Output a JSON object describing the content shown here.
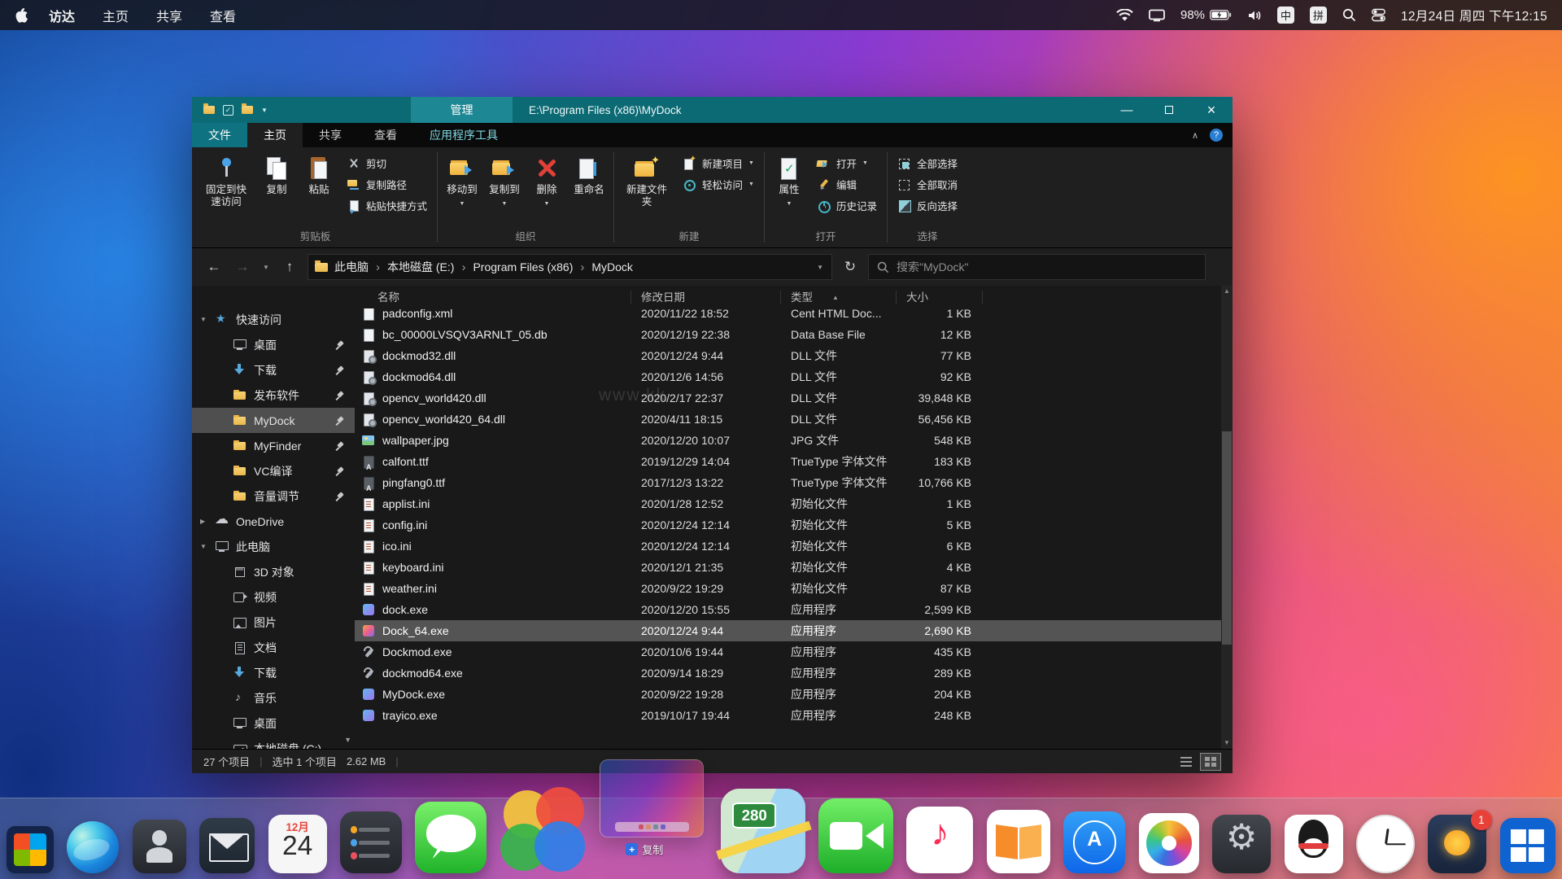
{
  "watermark": "www.kk",
  "menubar": {
    "app_menus": [
      "访达",
      "主页",
      "共享",
      "查看"
    ],
    "battery_percent": "98%",
    "input_cn": "中",
    "input_pin": "拼",
    "datetime": "12月24日 周四 下午12:15"
  },
  "window": {
    "manage_label": "管理",
    "title": "E:\\Program Files (x86)\\MyDock",
    "tabs": [
      {
        "label": "文件",
        "accent": true
      },
      {
        "label": "主页",
        "active": true
      },
      {
        "label": "共享"
      },
      {
        "label": "查看"
      },
      {
        "label": "应用程序工具",
        "contextual": true
      }
    ]
  },
  "ribbon": {
    "groups": [
      {
        "label": "剪贴板",
        "large": [
          {
            "label": "固定到快速访问",
            "icon": "pin"
          },
          {
            "label": "复制",
            "icon": "copy"
          },
          {
            "label": "粘贴",
            "icon": "paste"
          }
        ],
        "small": [
          {
            "label": "剪切",
            "icon": "cut"
          },
          {
            "label": "复制路径",
            "icon": "path"
          },
          {
            "label": "粘贴快捷方式",
            "icon": "shortcut"
          }
        ]
      },
      {
        "label": "组织",
        "large": [
          {
            "label": "移动到",
            "icon": "moveto",
            "dd": true
          },
          {
            "label": "复制到",
            "icon": "copyto",
            "dd": true
          },
          {
            "label": "删除",
            "icon": "delete",
            "dd": true
          },
          {
            "label": "重命名",
            "icon": "rename"
          }
        ]
      },
      {
        "label": "新建",
        "large": [
          {
            "label": "新建文件夹",
            "icon": "newfolder"
          }
        ],
        "small": [
          {
            "label": "新建项目",
            "icon": "newitem",
            "dd": true
          },
          {
            "label": "轻松访问",
            "icon": "easyaccess",
            "dd": true
          }
        ]
      },
      {
        "label": "打开",
        "large": [
          {
            "label": "属性",
            "icon": "properties",
            "dd": true
          }
        ],
        "small": [
          {
            "label": "打开",
            "icon": "open",
            "dd": true
          },
          {
            "label": "编辑",
            "icon": "edit"
          },
          {
            "label": "历史记录",
            "icon": "history"
          }
        ]
      },
      {
        "label": "选择",
        "small": [
          {
            "label": "全部选择",
            "icon": "selectall"
          },
          {
            "label": "全部取消",
            "icon": "selectnone"
          },
          {
            "label": "反向选择",
            "icon": "invert"
          }
        ]
      }
    ]
  },
  "address": {
    "crumbs": [
      "此电脑",
      "本地磁盘 (E:)",
      "Program Files (x86)",
      "MyDock"
    ],
    "search_placeholder": "搜索\"MyDock\""
  },
  "sidebar": {
    "items": [
      {
        "label": "快速访问",
        "icon": "star",
        "expand": true
      },
      {
        "label": "桌面",
        "icon": "desktop",
        "indent": true,
        "pin": true
      },
      {
        "label": "下载",
        "icon": "download",
        "indent": true,
        "pin": true
      },
      {
        "label": "发布软件",
        "icon": "folder",
        "indent": true,
        "pin": true
      },
      {
        "label": "MyDock",
        "icon": "folder",
        "indent": true,
        "pin": true,
        "selected": true
      },
      {
        "label": "MyFinder",
        "icon": "folder",
        "indent": true,
        "pin": true
      },
      {
        "label": "VC编译",
        "icon": "folder",
        "indent": true,
        "pin": true
      },
      {
        "label": "音量调节",
        "icon": "folder",
        "indent": true,
        "pin": true
      },
      {
        "label": "OneDrive",
        "icon": "cloud",
        "expand": false
      },
      {
        "label": "此电脑",
        "icon": "pc",
        "expand": true
      },
      {
        "label": "3D 对象",
        "icon": "cube",
        "indent": true
      },
      {
        "label": "视频",
        "icon": "video",
        "indent": true
      },
      {
        "label": "图片",
        "icon": "image",
        "indent": true
      },
      {
        "label": "文档",
        "icon": "doc",
        "indent": true
      },
      {
        "label": "下载",
        "icon": "download",
        "indent": true
      },
      {
        "label": "音乐",
        "icon": "music",
        "indent": true
      },
      {
        "label": "桌面",
        "icon": "desktop",
        "indent": true
      },
      {
        "label": "本地磁盘 (C:)",
        "icon": "disk",
        "indent": true
      }
    ]
  },
  "columns": [
    {
      "label": "名称"
    },
    {
      "label": "修改日期"
    },
    {
      "label": "类型",
      "sort": "asc"
    },
    {
      "label": "大小"
    }
  ],
  "files": {
    "rows": [
      {
        "icon": "xml",
        "name": "padconfig.xml",
        "date": "2020/11/22 18:52",
        "type": "Cent HTML Doc...",
        "size": "1 KB"
      },
      {
        "icon": "db",
        "name": "bc_00000LVSQV3ARNLT_05.db",
        "date": "2020/12/19 22:38",
        "type": "Data Base File",
        "size": "12 KB"
      },
      {
        "icon": "dll",
        "name": "dockmod32.dll",
        "date": "2020/12/24 9:44",
        "type": "DLL 文件",
        "size": "77 KB"
      },
      {
        "icon": "dll",
        "name": "dockmod64.dll",
        "date": "2020/12/6 14:56",
        "type": "DLL 文件",
        "size": "92 KB"
      },
      {
        "icon": "dll",
        "name": "opencv_world420.dll",
        "date": "2020/2/17 22:37",
        "type": "DLL 文件",
        "size": "39,848 KB"
      },
      {
        "icon": "dll",
        "name": "opencv_world420_64.dll",
        "date": "2020/4/11 18:15",
        "type": "DLL 文件",
        "size": "56,456 KB"
      },
      {
        "icon": "jpg",
        "name": "wallpaper.jpg",
        "date": "2020/12/20 10:07",
        "type": "JPG 文件",
        "size": "548 KB"
      },
      {
        "icon": "ttf",
        "name": "calfont.ttf",
        "date": "2019/12/29 14:04",
        "type": "TrueType 字体文件",
        "size": "183 KB"
      },
      {
        "icon": "ttf",
        "name": "pingfang0.ttf",
        "date": "2017/12/3 13:22",
        "type": "TrueType 字体文件",
        "size": "10,766 KB"
      },
      {
        "icon": "ini",
        "name": "applist.ini",
        "date": "2020/1/28 12:52",
        "type": "初始化文件",
        "size": "1 KB"
      },
      {
        "icon": "ini",
        "name": "config.ini",
        "date": "2020/12/24 12:14",
        "type": "初始化文件",
        "size": "5 KB"
      },
      {
        "icon": "ini",
        "name": "ico.ini",
        "date": "2020/12/24 12:14",
        "type": "初始化文件",
        "size": "6 KB"
      },
      {
        "icon": "ini",
        "name": "keyboard.ini",
        "date": "2020/12/1 21:35",
        "type": "初始化文件",
        "size": "4 KB"
      },
      {
        "icon": "ini",
        "name": "weather.ini",
        "date": "2020/9/22 19:29",
        "type": "初始化文件",
        "size": "87 KB"
      },
      {
        "icon": "exe",
        "name": "dock.exe",
        "date": "2020/12/20 15:55",
        "type": "应用程序",
        "size": "2,599 KB"
      },
      {
        "icon": "exe2",
        "name": "Dock_64.exe",
        "date": "2020/12/24 9:44",
        "type": "应用程序",
        "size": "2,690 KB",
        "selected": true
      },
      {
        "icon": "tool",
        "name": "Dockmod.exe",
        "date": "2020/10/6 19:44",
        "type": "应用程序",
        "size": "435 KB"
      },
      {
        "icon": "tool",
        "name": "dockmod64.exe",
        "date": "2020/9/14 18:29",
        "type": "应用程序",
        "size": "289 KB"
      },
      {
        "icon": "exe",
        "name": "MyDock.exe",
        "date": "2020/9/22 19:28",
        "type": "应用程序",
        "size": "204 KB"
      },
      {
        "icon": "exe",
        "name": "trayico.exe",
        "date": "2019/10/17 19:44",
        "type": "应用程序",
        "size": "248 KB"
      }
    ]
  },
  "status": {
    "count": "27 个项目",
    "selection": "选中 1 个项目",
    "selection_size": "2.62 MB"
  },
  "dock": {
    "drag_plus": "+",
    "drag_label": "复制",
    "items": [
      {
        "name": "start-menu",
        "type": "start",
        "size": 58
      },
      {
        "name": "edge",
        "type": "edge",
        "size": 64
      },
      {
        "name": "contacts",
        "type": "contacts",
        "size": 66
      },
      {
        "name": "mail",
        "type": "mail",
        "size": 68
      },
      {
        "name": "calendar",
        "type": "calendar",
        "size": 72,
        "month": "12月",
        "day": "24"
      },
      {
        "name": "reminders",
        "type": "reminders",
        "size": 76
      },
      {
        "name": "messages",
        "type": "messages",
        "size": 88
      },
      {
        "name": "colors",
        "type": "colors",
        "size": 106
      },
      {
        "name": "drag-ghost",
        "type": "ghost"
      },
      {
        "name": "maps",
        "type": "maps",
        "size": 104,
        "shield": "280"
      },
      {
        "name": "facetime",
        "type": "facetime",
        "size": 92
      },
      {
        "name": "music",
        "type": "music",
        "size": 82
      },
      {
        "name": "books",
        "type": "books",
        "size": 78
      },
      {
        "name": "app-store",
        "type": "appstore",
        "size": 76
      },
      {
        "name": "photos",
        "type": "photos",
        "size": 74
      },
      {
        "name": "settings",
        "type": "settings",
        "size": 72
      },
      {
        "name": "qq",
        "type": "qq",
        "size": 72
      },
      {
        "name": "clock",
        "type": "clock",
        "size": 72
      },
      {
        "name": "weather",
        "type": "weather",
        "size": 72,
        "badge": "1"
      },
      {
        "name": "windows",
        "type": "windows",
        "size": 68
      }
    ]
  },
  "colors": {
    "accent_teal": "#0c6a74",
    "selection_gray": "#545454"
  }
}
